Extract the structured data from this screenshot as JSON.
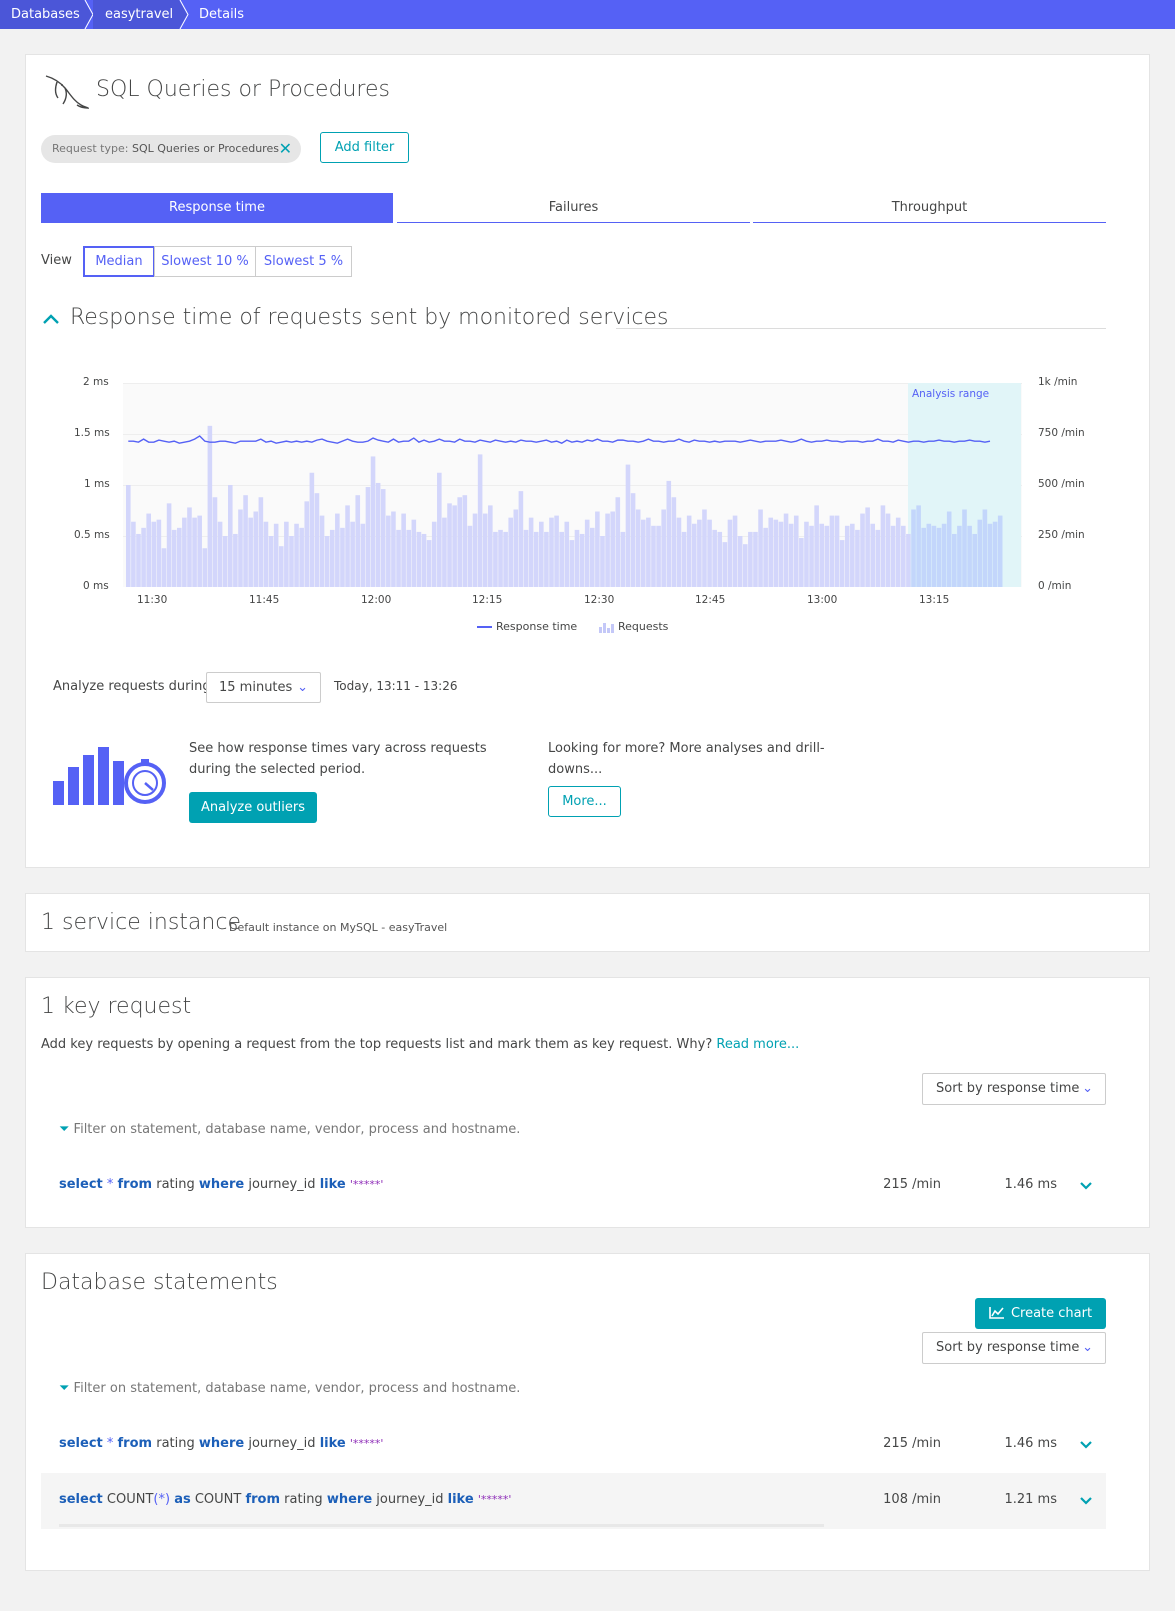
{
  "breadcrumb": [
    "Databases",
    "easytravel",
    "Details"
  ],
  "header": {
    "title": "SQL Queries or Procedures",
    "filter_chip": {
      "key": "Request type:",
      "value": "SQL Queries or Procedures"
    },
    "add_filter": "Add filter"
  },
  "tabs": [
    "Response time",
    "Failures",
    "Throughput"
  ],
  "view": {
    "label": "View",
    "options": [
      "Median",
      "Slowest 10 %",
      "Slowest 5 %"
    ],
    "selected": "Median"
  },
  "chart_section": {
    "title": "Response time of requests sent by monitored services"
  },
  "chart_data": {
    "type": "bar+line",
    "y_left_ticks": [
      "2 ms",
      "1.5 ms",
      "1 ms",
      "0.5 ms",
      "0 ms"
    ],
    "y_right_ticks": [
      "1k /min",
      "750 /min",
      "500 /min",
      "250 /min",
      "0 /min"
    ],
    "x_ticks": [
      "11:30",
      "11:45",
      "12:00",
      "12:15",
      "12:30",
      "12:45",
      "13:00",
      "13:15"
    ],
    "ylim_left_ms": [
      0,
      2
    ],
    "ylim_right_per_min": [
      0,
      1000
    ],
    "analysis_range_label": "Analysis range",
    "series": [
      {
        "name": "Response time",
        "unit": "ms",
        "values": [
          1.43,
          1.43,
          1.42,
          1.45,
          1.42,
          1.42,
          1.44,
          1.43,
          1.42,
          1.43,
          1.41,
          1.42,
          1.43,
          1.45,
          1.48,
          1.43,
          1.42,
          1.42,
          1.43,
          1.43,
          1.42,
          1.41,
          1.43,
          1.43,
          1.43,
          1.43,
          1.45,
          1.42,
          1.43,
          1.41,
          1.42,
          1.43,
          1.42,
          1.43,
          1.42,
          1.43,
          1.42,
          1.44,
          1.45,
          1.43,
          1.42,
          1.41,
          1.43,
          1.45,
          1.43,
          1.42,
          1.42,
          1.43,
          1.46,
          1.44,
          1.43,
          1.42,
          1.45,
          1.42,
          1.43,
          1.43,
          1.46,
          1.42,
          1.44,
          1.42,
          1.43,
          1.45,
          1.43,
          1.43,
          1.42,
          1.45,
          1.43,
          1.43,
          1.42,
          1.44,
          1.43,
          1.42,
          1.44,
          1.43,
          1.42,
          1.43,
          1.42,
          1.44,
          1.43,
          1.43,
          1.42,
          1.43,
          1.44,
          1.42,
          1.43,
          1.41,
          1.44,
          1.42,
          1.43,
          1.42,
          1.44,
          1.43,
          1.45,
          1.43,
          1.43,
          1.42,
          1.44,
          1.44,
          1.43,
          1.43,
          1.42,
          1.43,
          1.45,
          1.43,
          1.43,
          1.42,
          1.43,
          1.43,
          1.45,
          1.43,
          1.42,
          1.44,
          1.43,
          1.43,
          1.42,
          1.43,
          1.42,
          1.43,
          1.43,
          1.43,
          1.42,
          1.43,
          1.44,
          1.43,
          1.42,
          1.43,
          1.43,
          1.43,
          1.44,
          1.43,
          1.42,
          1.43,
          1.45,
          1.43,
          1.42,
          1.43,
          1.43,
          1.44,
          1.43,
          1.43,
          1.42,
          1.43,
          1.43,
          1.43,
          1.42,
          1.43,
          1.43,
          1.45,
          1.43,
          1.43,
          1.42,
          1.44,
          1.43,
          1.42,
          1.43,
          1.43,
          1.42,
          1.43,
          1.43,
          1.44,
          1.43,
          1.43,
          1.42,
          1.43,
          1.43,
          1.44,
          1.43,
          1.43,
          1.42,
          1.43
        ]
      },
      {
        "name": "Requests",
        "unit": "/min",
        "values": [
          500,
          320,
          260,
          290,
          360,
          320,
          330,
          190,
          410,
          280,
          290,
          340,
          390,
          340,
          350,
          190,
          790,
          440,
          320,
          250,
          500,
          260,
          380,
          450,
          340,
          370,
          440,
          320,
          250,
          310,
          200,
          320,
          250,
          310,
          290,
          420,
          560,
          460,
          350,
          250,
          280,
          360,
          290,
          400,
          320,
          450,
          310,
          490,
          640,
          510,
          480,
          350,
          370,
          280,
          360,
          280,
          330,
          270,
          260,
          230,
          320,
          560,
          340,
          410,
          400,
          440,
          450,
          300,
          360,
          650,
          360,
          400,
          270,
          280,
          270,
          340,
          380,
          470,
          280,
          340,
          270,
          320,
          270,
          340,
          350,
          270,
          320,
          230,
          280,
          260,
          330,
          290,
          370,
          250,
          360,
          370,
          440,
          270,
          600,
          460,
          380,
          330,
          340,
          300,
          300,
          380,
          520,
          440,
          340,
          270,
          350,
          310,
          330,
          380,
          330,
          280,
          270,
          220,
          330,
          350,
          250,
          210,
          270,
          270,
          380,
          290,
          340,
          330,
          320,
          360,
          310,
          350,
          240,
          320,
          300,
          400,
          310,
          300,
          350,
          350,
          230,
          300,
          310,
          280,
          360,
          390,
          310,
          280,
          400,
          360,
          300,
          340,
          300,
          260,
          380,
          400,
          290,
          310,
          300,
          290,
          310,
          370,
          260,
          300,
          380,
          300,
          260,
          330,
          380,
          310,
          320,
          350
        ]
      }
    ]
  },
  "analyze": {
    "label": "Analyze requests during",
    "duration": "15 minutes",
    "range": "Today, 13:11 - 13:26"
  },
  "outliers": {
    "text": "See how response times vary across requests during the selected period.",
    "button": "Analyze outliers"
  },
  "more": {
    "text": "Looking for more? More analyses and drill-downs...",
    "button": "More..."
  },
  "instances": {
    "title": "1 service instance",
    "subtitle": "Default instance on MySQL - easyTravel"
  },
  "key_requests": {
    "title": "1 key request",
    "description": "Add key requests by opening a request from the top requests list and mark them as key request. Why?",
    "read_more": "Read more...",
    "sort": "Sort by response time",
    "filter_placeholder": "Filter on statement, database name, vendor, process and hostname.",
    "rows": [
      {
        "rate": "215 /min",
        "time": "1.46 ms"
      }
    ]
  },
  "db_statements": {
    "title": "Database statements",
    "create_chart": "Create chart",
    "sort": "Sort by response time",
    "filter_placeholder": "Filter on statement, database name, vendor, process and hostname.",
    "rows": [
      {
        "rate": "215 /min",
        "time": "1.46 ms"
      },
      {
        "rate": "108 /min",
        "time": "1.21 ms"
      }
    ]
  },
  "sql": {
    "q1": {
      "select": "select",
      "star": "*",
      "from": "from",
      "table": "rating",
      "where": "where",
      "col": "journey_id",
      "like": "like",
      "val": "'*****'"
    },
    "q2": {
      "select": "select",
      "fn": "COUNT",
      "star": "(*)",
      "as": "as",
      "alias": "COUNT",
      "from": "from",
      "table": "rating",
      "where": "where",
      "col": "journey_id",
      "like": "like",
      "val": "'*****'"
    }
  },
  "colors": {
    "accent": "#5561f5",
    "teal": "#00a1b2",
    "bar": "#d3d6fb",
    "analysis_range": "#e1f5f8"
  }
}
